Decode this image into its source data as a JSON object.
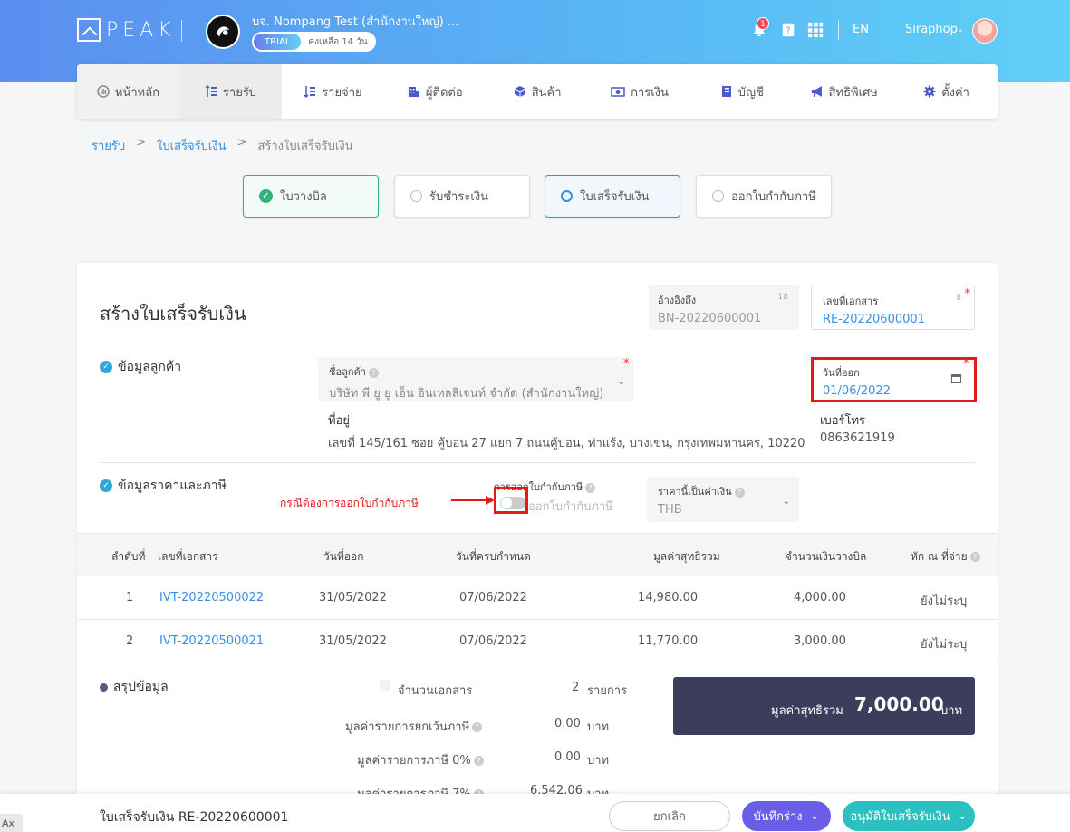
{
  "header": {
    "logo_text": "PEAK",
    "company_name": "บจ. Nompang Test (สำนักงานใหญ่) ...",
    "trial_label": "TRIAL",
    "trial_days": "คงเหลือ 14 วัน",
    "notification_count": "1",
    "language": "EN",
    "username": "Siraphop"
  },
  "nav": [
    {
      "label": "หน้าหลัก",
      "icon": "dashboard-icon"
    },
    {
      "label": "รายรับ",
      "icon": "income-icon"
    },
    {
      "label": "รายจ่าย",
      "icon": "expense-icon"
    },
    {
      "label": "ผู้ติดต่อ",
      "icon": "contacts-icon"
    },
    {
      "label": "สินค้า",
      "icon": "product-icon"
    },
    {
      "label": "การเงิน",
      "icon": "money-icon"
    },
    {
      "label": "บัญชี",
      "icon": "book-icon"
    },
    {
      "label": "สิทธิพิเศษ",
      "icon": "megaphone-icon"
    },
    {
      "label": "ตั้งค่า",
      "icon": "gear-icon"
    }
  ],
  "breadcrumb": [
    "รายรับ",
    "ใบเสร็จรับเงิน",
    "สร้างใบเสร็จรับเงิน"
  ],
  "steps": [
    {
      "label": "ใบวางบิล",
      "state": "done"
    },
    {
      "label": "รับชำระเงิน",
      "state": "pending"
    },
    {
      "label": "ใบเสร็จรับเงิน",
      "state": "current"
    },
    {
      "label": "ออกใบกำกับภาษี",
      "state": "pending"
    }
  ],
  "form": {
    "title": "สร้างใบเสร็จรับเงิน",
    "reference": {
      "label": "อ้างอิงถึง",
      "value": "BN-20220600001",
      "count": "18"
    },
    "doc_number": {
      "label": "เลขที่เอกสาร",
      "value": "RE-20220600001",
      "count": "8",
      "required": "*"
    },
    "customer_section": "ข้อมูลลูกค้า",
    "customer": {
      "label": "ชื่อลูกค้า",
      "value": "บริษัท พี ยู ยู เอ็น อินเทลลิเจนท์ จำกัด (สำนักงานใหญ่)",
      "required": "*"
    },
    "issue_date": {
      "label": "วันที่ออก",
      "value": "01/06/2022",
      "required": "*"
    },
    "address": {
      "label": "ที่อยู่",
      "value": "เลขที่ 145/161 ซอย คู้บอน 27 แยก 7 ถนนคู้บอน, ท่าแร้ง, บางเขน, กรุงเทพมหานคร, 10220"
    },
    "phone": {
      "label": "เบอร์โทร",
      "value": "0863621919"
    },
    "price_section": "ข้อมูลราคาและภาษี",
    "tax_invoice": {
      "label": "การออกใบกำกับภาษี",
      "toggle_text": "ออกใบกำกับภาษี",
      "on": false
    },
    "annotation": "กรณีต้องการออกใบกำกับภาษี",
    "currency": {
      "label": "ราคานี้เป็นค่าเงิน",
      "value": "THB"
    }
  },
  "table": {
    "columns": [
      "ลำดับที่",
      "เลขที่เอกสาร",
      "วันที่ออก",
      "วันที่ครบกำหนด",
      "มูลค่าสุทธิรวม",
      "จำนวนเงินวางบิล",
      "หัก ณ ที่จ่าย"
    ],
    "rows": [
      {
        "no": "1",
        "doc": "IVT-20220500022",
        "issue": "31/05/2022",
        "due": "07/06/2022",
        "net": "14,980.00",
        "billed": "4,000.00",
        "wht": "ยังไม่ระบุ"
      },
      {
        "no": "2",
        "doc": "IVT-20220500021",
        "issue": "31/05/2022",
        "due": "07/06/2022",
        "net": "11,770.00",
        "billed": "3,000.00",
        "wht": "ยังไม่ระบุ"
      }
    ]
  },
  "summary": {
    "title": "สรุปข้อมูล",
    "doc_count_label": "จำนวนเอกสาร",
    "doc_count": "2",
    "doc_count_unit": "รายการ",
    "exempt_label": "มูลค่ารายการยกเว้นภาษี",
    "exempt_value": "0.00",
    "zero_label": "มูลค่ารายการภาษี 0%",
    "zero_value": "0.00",
    "vat7_label": "มูลค่ารายการภาษี 7%",
    "vat7_value": "6,542.06",
    "unit": "บาท",
    "total_label": "มูลค่าสุทธิรวม",
    "total_value": "7,000.00",
    "total_unit": "บาท"
  },
  "footer": {
    "title": "ใบเสร็จรับเงิน RE-20220600001",
    "cancel": "ยกเลิก",
    "draft": "บันทึกร่าง",
    "approve": "อนุมัติใบเสร็จรับเงิน"
  },
  "corner_tag": "Ax"
}
